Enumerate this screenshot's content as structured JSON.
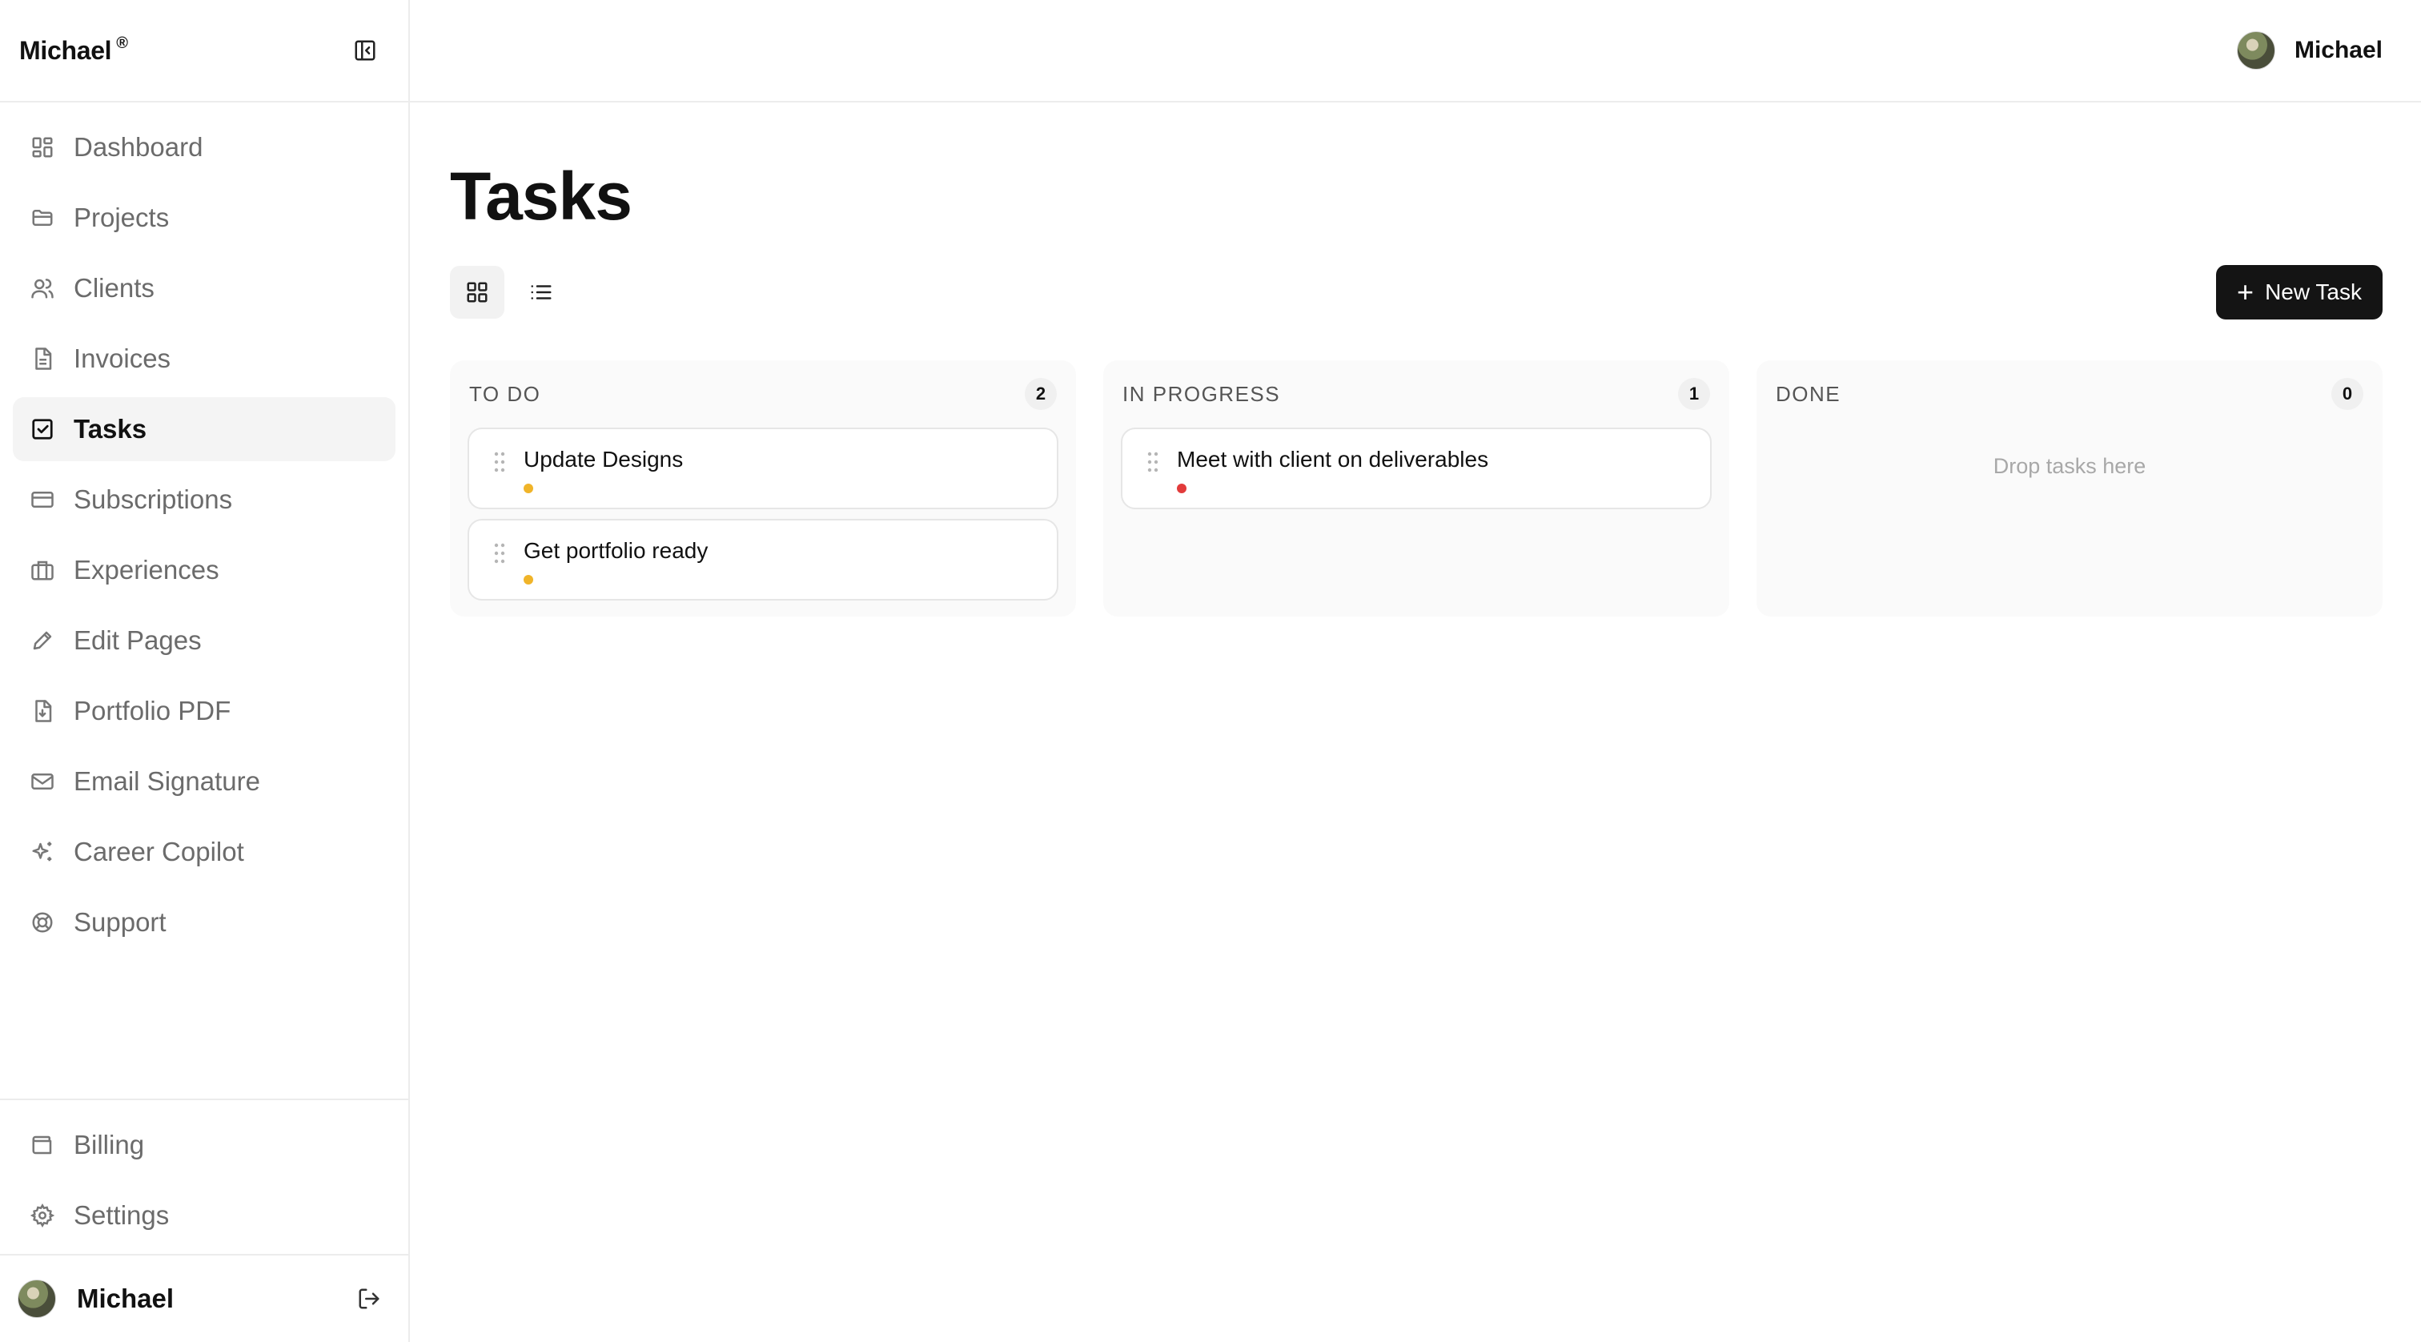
{
  "sidebar": {
    "brand": "Michael",
    "brand_mark": "®",
    "nav": [
      {
        "label": "Dashboard",
        "icon": "dashboard-icon"
      },
      {
        "label": "Projects",
        "icon": "folder-icon"
      },
      {
        "label": "Clients",
        "icon": "users-icon"
      },
      {
        "label": "Invoices",
        "icon": "document-icon"
      },
      {
        "label": "Tasks",
        "icon": "checkbox-icon",
        "active": true
      },
      {
        "label": "Subscriptions",
        "icon": "card-icon"
      },
      {
        "label": "Experiences",
        "icon": "briefcase-icon"
      },
      {
        "label": "Edit Pages",
        "icon": "pen-icon"
      },
      {
        "label": "Portfolio PDF",
        "icon": "pdf-icon"
      },
      {
        "label": "Email Signature",
        "icon": "mail-icon"
      },
      {
        "label": "Career Copilot",
        "icon": "sparkles-icon"
      },
      {
        "label": "Support",
        "icon": "lifebuoy-icon"
      }
    ],
    "bottom_nav": [
      {
        "label": "Billing",
        "icon": "wallet-icon"
      },
      {
        "label": "Settings",
        "icon": "gear-icon"
      }
    ],
    "user_name": "Michael"
  },
  "topbar": {
    "user_name": "Michael"
  },
  "page": {
    "title": "Tasks",
    "new_task_label": "New Task"
  },
  "board": {
    "columns": [
      {
        "title": "TO DO",
        "count": "2",
        "cards": [
          {
            "title": "Update Designs",
            "priority_color": "#f0b429"
          },
          {
            "title": "Get portfolio ready",
            "priority_color": "#f0b429"
          }
        ]
      },
      {
        "title": "IN PROGRESS",
        "count": "1",
        "cards": [
          {
            "title": "Meet with client on deliverables",
            "priority_color": "#e23b3b"
          }
        ]
      },
      {
        "title": "DONE",
        "count": "0",
        "cards": [],
        "empty_text": "Drop tasks here"
      }
    ]
  },
  "colors": {
    "primary_button": "#141414",
    "active_nav_bg": "#f4f4f4"
  }
}
